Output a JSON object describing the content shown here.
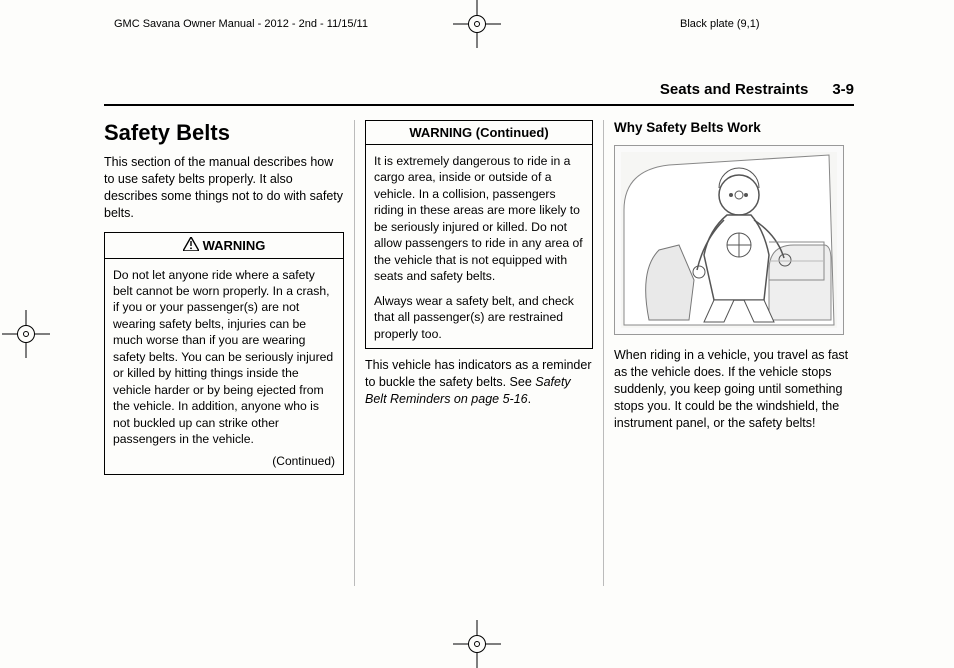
{
  "meta": {
    "doc_title": "GMC Savana Owner Manual - 2012 - 2nd - 11/15/11",
    "plate": "Black plate (9,1)"
  },
  "header": {
    "section": "Seats and Restraints",
    "page": "3-9"
  },
  "col1": {
    "heading": "Safety Belts",
    "intro": "This section of the manual describes how to use safety belts properly. It also describes some things not to do with safety belts.",
    "warning_label": "WARNING",
    "warning_text": "Do not let anyone ride where a safety belt cannot be worn properly. In a crash, if you or your passenger(s) are not wearing safety belts, injuries can be much worse than if you are wearing safety belts. You can be seriously injured or killed by hitting things inside the vehicle harder or by being ejected from the vehicle. In addition, anyone who is not buckled up can strike other passengers in the vehicle.",
    "continued": "(Continued)"
  },
  "col2": {
    "warning_label": "WARNING (Continued)",
    "warning_p1": "It is extremely dangerous to ride in a cargo area, inside or outside of a vehicle. In a collision, passengers riding in these areas are more likely to be seriously injured or killed. Do not allow passengers to ride in any area of the vehicle that is not equipped with seats and safety belts.",
    "warning_p2": "Always wear a safety belt, and check that all passenger(s) are restrained properly too.",
    "after_p1a": "This vehicle has indicators as a reminder to buckle the safety belts. See ",
    "after_p1b": "Safety Belt Reminders on page 5‑16",
    "after_p1c": "."
  },
  "col3": {
    "subhead": "Why Safety Belts Work",
    "illus_alt": "crash-test-dummy-illustration",
    "body": "When riding in a vehicle, you travel as fast as the vehicle does. If the vehicle stops suddenly, you keep going until something stops you. It could be the windshield, the instrument panel, or the safety belts!"
  }
}
